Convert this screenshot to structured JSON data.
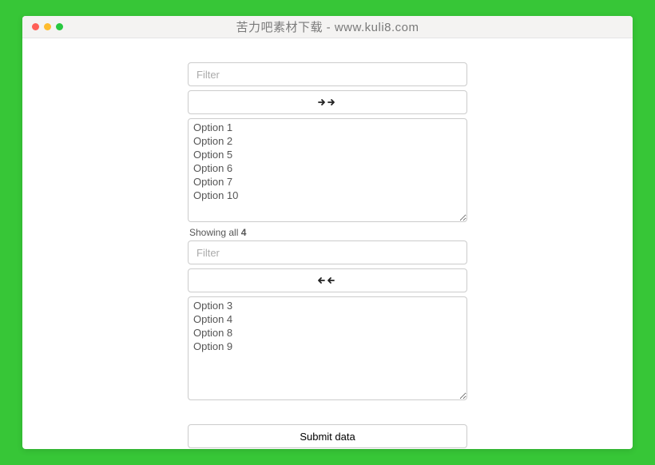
{
  "window": {
    "title": "苦力吧素材下载 - www.kuli8.com"
  },
  "top": {
    "filter_placeholder": "Filter",
    "options": [
      "Option 1",
      "Option 2",
      "Option 5",
      "Option 6",
      "Option 7",
      "Option 10"
    ]
  },
  "status": {
    "prefix": "Showing all ",
    "count": "4"
  },
  "bottom": {
    "filter_placeholder": "Filter",
    "options": [
      "Option 3",
      "Option 4",
      "Option 8",
      "Option 9"
    ]
  },
  "submit_label": "Submit data",
  "icons": {
    "move_right": "➔ ➔",
    "move_left": "← ←"
  }
}
